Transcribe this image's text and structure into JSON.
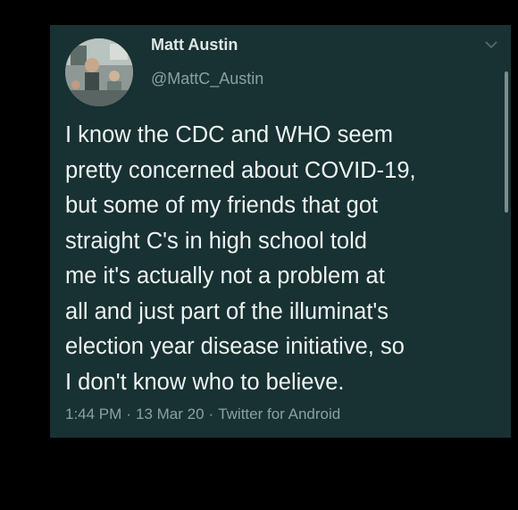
{
  "author": {
    "display_name": "Matt Austin",
    "handle": "@MattC_Austin"
  },
  "tweet": {
    "lines": [
      "I know the CDC and WHO seem",
      "pretty concerned about COVID-19,",
      "but some of my friends that got",
      "straight C's in high school told",
      "me it's actually not a problem at",
      "all and just part of the illuminat's",
      "election year disease initiative, so",
      "I don't know who to believe."
    ]
  },
  "meta": {
    "time": "1:44 PM",
    "date": "13 Mar 20",
    "source": "Twitter for Android",
    "separator": "·"
  },
  "icons": {
    "menu": "chevron-down-icon"
  },
  "colors": {
    "card_background": "#183132",
    "page_background": "#000000",
    "text_primary": "#eef3f2",
    "text_secondary": "#8aa19f"
  }
}
